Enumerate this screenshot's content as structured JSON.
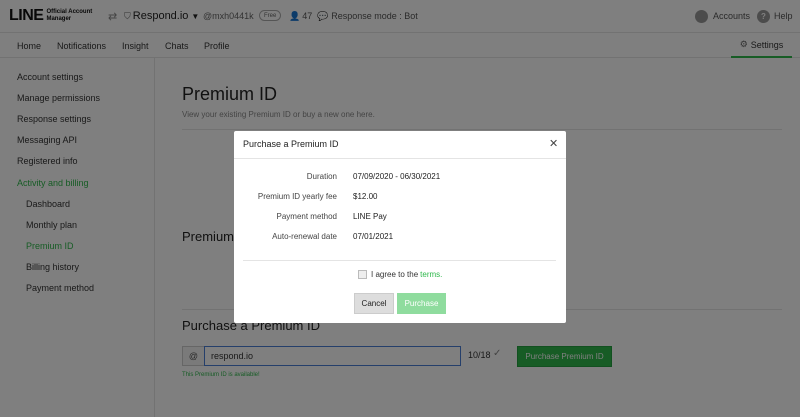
{
  "header": {
    "logo_main": "LINE",
    "logo_sub_line1": "Official Account",
    "logo_sub_line2": "Manager",
    "account_name": "Respond.io",
    "handle": "@mxh0441k",
    "plan_badge": "Free",
    "friends_count": "47",
    "response_mode": "Response mode : Bot",
    "accounts_label": "Accounts",
    "help_label": "Help"
  },
  "nav": {
    "tabs": [
      {
        "label": "Home"
      },
      {
        "label": "Notifications"
      },
      {
        "label": "Insight"
      },
      {
        "label": "Chats"
      },
      {
        "label": "Profile"
      }
    ],
    "settings_label": "Settings"
  },
  "sidebar": {
    "items": [
      {
        "label": "Account settings"
      },
      {
        "label": "Manage permissions"
      },
      {
        "label": "Response settings"
      },
      {
        "label": "Messaging API"
      },
      {
        "label": "Registered info"
      },
      {
        "label": "Activity and billing"
      },
      {
        "label": "Dashboard"
      },
      {
        "label": "Monthly plan"
      },
      {
        "label": "Premium ID"
      },
      {
        "label": "Billing history"
      },
      {
        "label": "Payment method"
      }
    ]
  },
  "main": {
    "title": "Premium ID",
    "subtitle": "View your existing Premium ID or buy a new one here.",
    "section_premium": "Premium",
    "section_purchase": "Purchase a Premium ID",
    "at_symbol": "@",
    "input_value": "respond.io",
    "counter": "10/18",
    "purchase_button": "Purchase Premium ID",
    "available_message": "This Premium ID is available!"
  },
  "modal": {
    "title": "Purchase a Premium ID",
    "rows": [
      {
        "label": "Duration",
        "value": "07/09/2020 - 06/30/2021"
      },
      {
        "label": "Premium ID yearly fee",
        "value": "$12.00"
      },
      {
        "label": "Payment method",
        "value": "LINE Pay"
      },
      {
        "label": "Auto-renewal date",
        "value": "07/01/2021"
      }
    ],
    "agree_text": "I agree to the",
    "terms_link": "terms.",
    "cancel_label": "Cancel",
    "purchase_label": "Purchase"
  },
  "colors": {
    "accent": "#2eb84b",
    "accent_disabled": "#8fdc9e",
    "overlay": "rgba(0,0,0,0.5)"
  }
}
